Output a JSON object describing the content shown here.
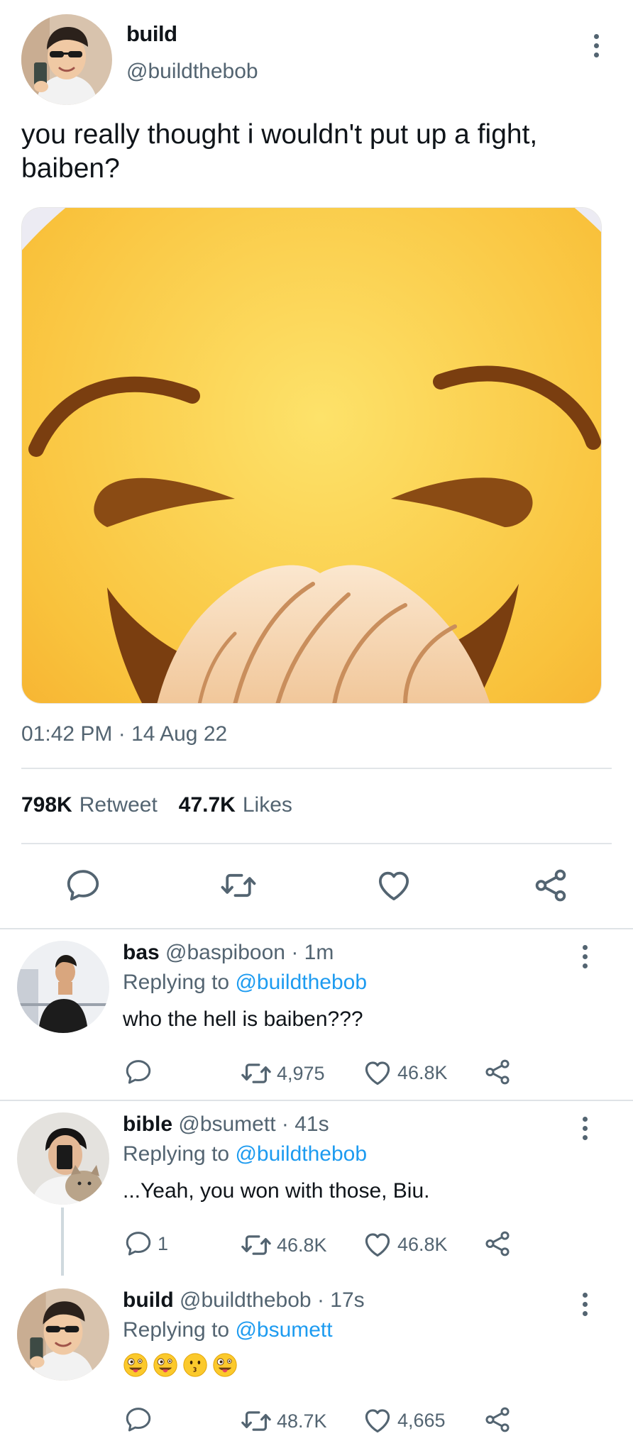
{
  "main": {
    "name": "build",
    "handle": "@buildthebob",
    "text": "you really thought i wouldn't put up a fight, baiben?",
    "timestamp": "01:42 PM · 14 Aug 22",
    "retweets_count": "798K",
    "retweets_label": "Retweet",
    "likes_count": "47.7K",
    "likes_label": "Likes"
  },
  "replies": [
    {
      "name": "bas",
      "handle": "@baspiboon",
      "time": "· 1m",
      "replying_label": "Replying to",
      "replying_to": "@buildthebob",
      "text": "who the hell is baiben???",
      "reply_count": "",
      "retweet_count": "4,975",
      "like_count": "46.8K"
    },
    {
      "name": "bible",
      "handle": "@bsumett",
      "time": "· 41s",
      "replying_label": "Replying to",
      "replying_to": "@buildthebob",
      "text": "...Yeah, you won with those, Biu.",
      "reply_count": "1",
      "retweet_count": "46.8K",
      "like_count": "46.8K"
    },
    {
      "name": "build",
      "handle": "@buildthebob",
      "time": "· 17s",
      "replying_label": "Replying to",
      "replying_to": "@bsumett",
      "text": "",
      "emojis": [
        "zany-face-emoji",
        "zany-face-emoji",
        "kissing-face-emoji",
        "zany-face-emoji"
      ],
      "reply_count": "",
      "retweet_count": "48.7K",
      "like_count": "4,665"
    }
  ],
  "colors": {
    "link": "#1d9bf0",
    "secondary_text": "#536471",
    "primary_text": "#0f1419",
    "divider": "#e1e5e8"
  },
  "icons": [
    "comment-icon",
    "retweet-icon",
    "heart-icon",
    "share-icon",
    "more-icon"
  ]
}
